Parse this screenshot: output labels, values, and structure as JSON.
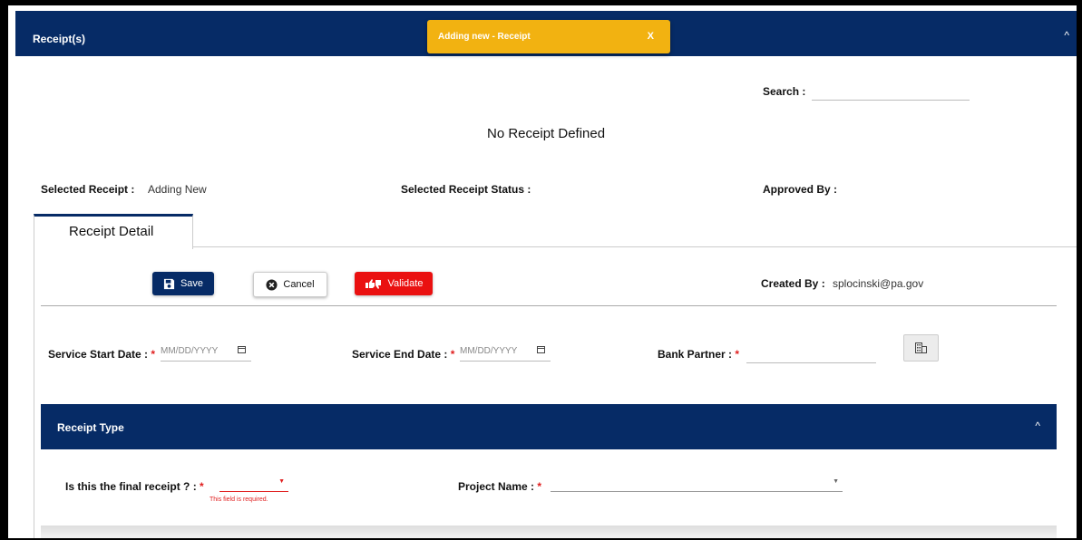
{
  "header": {
    "title": "Receipt(s)",
    "collapse_icon": "chevron-up-icon"
  },
  "toast": {
    "message": "Adding new - Receipt",
    "close_label": "X"
  },
  "search": {
    "label": "Search :",
    "value": ""
  },
  "empty_message": "No Receipt Defined",
  "selection": {
    "selected_receipt_label": "Selected Receipt :",
    "selected_receipt_value": "Adding New",
    "status_label": "Selected Receipt Status :",
    "status_value": "",
    "approved_by_label": "Approved By :",
    "approved_by_value": ""
  },
  "tabs": [
    {
      "label": "Receipt Detail",
      "active": true
    }
  ],
  "actions": {
    "save_label": "Save",
    "cancel_label": "Cancel",
    "validate_label": "Validate"
  },
  "created_by": {
    "label": "Created By :",
    "value": "splocinski@pa.gov"
  },
  "fields": {
    "service_start_label": "Service Start Date :",
    "service_start_placeholder": "MM/DD/YYYY",
    "service_end_label": "Service End Date :",
    "service_end_placeholder": "MM/DD/YYYY",
    "bank_partner_label": "Bank Partner :",
    "bank_partner_value": "",
    "required_marker": "*"
  },
  "receipt_type": {
    "title": "Receipt Type",
    "final_receipt_label": "Is this the final receipt ? :",
    "final_receipt_value": "",
    "final_receipt_error": "This field is required.",
    "project_name_label": "Project Name :",
    "project_name_value": ""
  },
  "colors": {
    "navy": "#062b66",
    "toast": "#f2b211",
    "danger": "#ea1010",
    "required": "#e01e1e"
  }
}
